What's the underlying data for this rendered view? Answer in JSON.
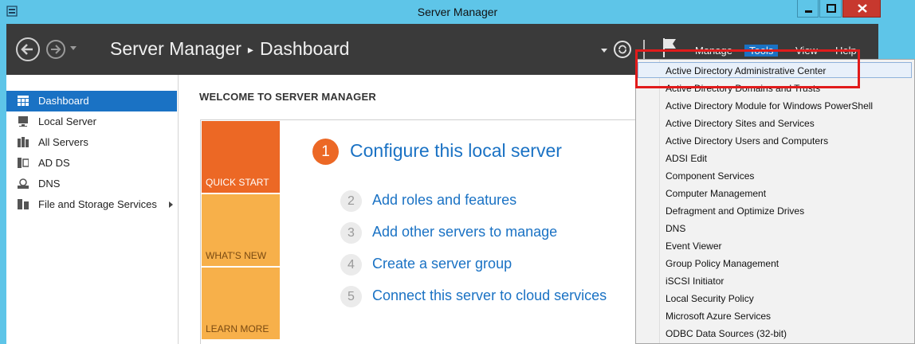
{
  "window": {
    "title": "Server Manager"
  },
  "header": {
    "app_name": "Server Manager",
    "separator": "▸",
    "page": "Dashboard",
    "menu": {
      "manage": "Manage",
      "tools": "Tools",
      "view": "View",
      "help": "Help"
    }
  },
  "sidebar": {
    "items": [
      {
        "label": "Dashboard",
        "icon": "dashboard-icon"
      },
      {
        "label": "Local Server",
        "icon": "server-icon"
      },
      {
        "label": "All Servers",
        "icon": "servers-icon"
      },
      {
        "label": "AD DS",
        "icon": "ad-ds-icon"
      },
      {
        "label": "DNS",
        "icon": "dns-icon"
      },
      {
        "label": "File and Storage Services",
        "icon": "file-storage-icon"
      }
    ]
  },
  "main": {
    "welcome": "WELCOME TO SERVER MANAGER",
    "tiles": {
      "quick_start": "QUICK START",
      "whats_new": "WHAT'S NEW",
      "learn_more": "LEARN MORE"
    },
    "steps": [
      {
        "num": "1",
        "text": "Configure this local server"
      },
      {
        "num": "2",
        "text": "Add roles and features"
      },
      {
        "num": "3",
        "text": "Add other servers to manage"
      },
      {
        "num": "4",
        "text": "Create a server group"
      },
      {
        "num": "5",
        "text": "Connect this server to cloud services"
      }
    ]
  },
  "tools_menu": {
    "items": [
      "Active Directory Administrative Center",
      "Active Directory Domains and Trusts",
      "Active Directory Module for Windows PowerShell",
      "Active Directory Sites and Services",
      "Active Directory Users and Computers",
      "ADSI Edit",
      "Component Services",
      "Computer Management",
      "Defragment and Optimize Drives",
      "DNS",
      "Event Viewer",
      "Group Policy Management",
      "iSCSI Initiator",
      "Local Security Policy",
      "Microsoft Azure Services",
      "ODBC Data Sources (32-bit)"
    ],
    "hovered_index": 0
  },
  "colors": {
    "titlebar": "#5ec5e8",
    "header": "#3a3a3a",
    "accent": "#1a72c4",
    "quick_start": "#ec6825",
    "tile_secondary": "#f7b04a",
    "highlight": "#e11b1b"
  }
}
